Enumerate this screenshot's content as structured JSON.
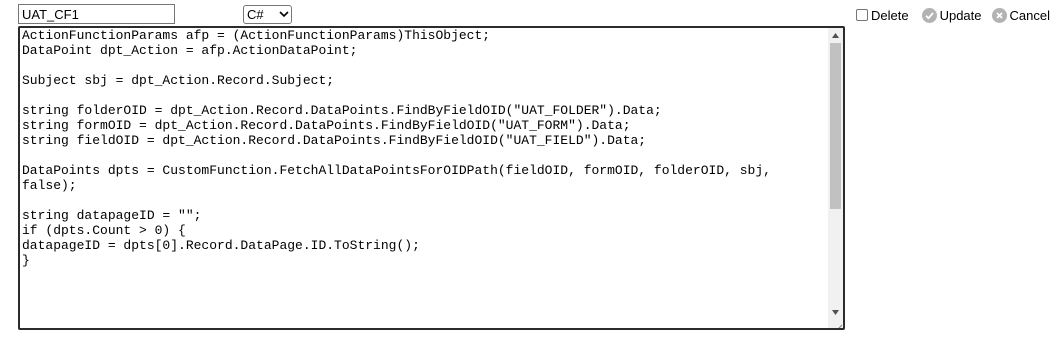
{
  "name_field": {
    "value": "UAT_CF1"
  },
  "language_select": {
    "selected": "C#"
  },
  "actions": {
    "delete_label": "Delete",
    "update_label": "Update",
    "cancel_label": "Cancel"
  },
  "editor": {
    "lines": [
      "ActionFunctionParams afp = (ActionFunctionParams)ThisObject;",
      "DataPoint dpt_Action = afp.ActionDataPoint;",
      "",
      "Subject sbj = dpt_Action.Record.Subject;",
      "",
      "string folderOID = dpt_Action.Record.DataPoints.FindByFieldOID(\"UAT_FOLDER\").Data;",
      "string formOID = dpt_Action.Record.DataPoints.FindByFieldOID(\"UAT_FORM\").Data;",
      "string fieldOID = dpt_Action.Record.DataPoints.FindByFieldOID(\"UAT_FIELD\").Data;",
      "",
      "DataPoints dpts = CustomFunction.FetchAllDataPointsForOIDPath(fieldOID, formOID, folderOID, sbj,",
      "false);",
      "",
      "string datapageID = \"\";",
      "if (dpts.Count > 0) {",
      "datapageID = dpts[0].Record.DataPage.ID.ToString();",
      "}"
    ]
  }
}
